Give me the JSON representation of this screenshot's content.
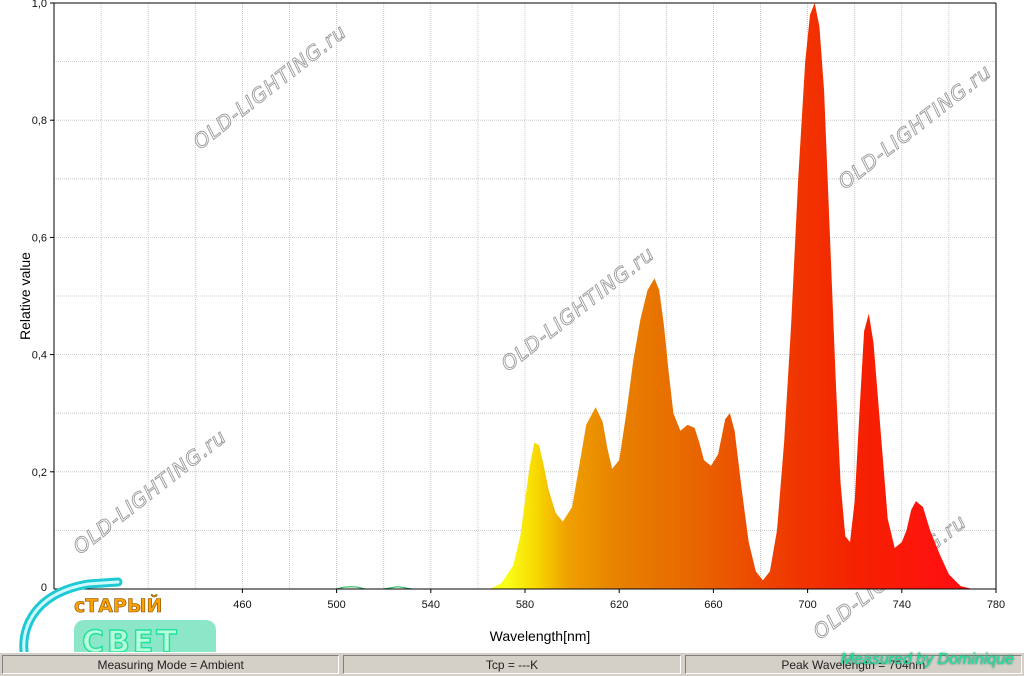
{
  "chart_data": {
    "type": "area",
    "xlabel": "Wavelength[nm]",
    "ylabel": "Relative value",
    "xlim": [
      380,
      780
    ],
    "ylim": [
      0,
      1
    ],
    "grid": true,
    "x_ticks": [
      "460",
      "500",
      "540",
      "580",
      "620",
      "660",
      "700",
      "740",
      "780"
    ],
    "y_ticks": [
      "0,2",
      "0,4",
      "0,6",
      "0,8",
      "1,0"
    ],
    "y_zero_label": "0",
    "x": [
      565,
      570,
      575,
      578,
      580,
      582,
      584,
      586,
      588,
      590,
      593,
      596,
      600,
      603,
      606,
      610,
      613,
      615,
      617,
      620,
      623,
      626,
      629,
      632,
      635,
      637,
      639,
      641,
      643,
      646,
      649,
      652,
      654,
      656,
      659,
      662,
      665,
      667,
      669,
      672,
      675,
      678,
      681,
      684,
      687,
      690,
      693,
      696,
      699,
      701,
      703,
      705,
      707,
      709,
      712,
      714,
      716,
      718,
      720,
      722,
      724,
      726,
      728,
      731,
      734,
      737,
      740,
      742,
      744,
      746,
      749,
      752,
      756,
      760,
      765,
      770
    ],
    "values": [
      0.0,
      0.01,
      0.04,
      0.09,
      0.15,
      0.21,
      0.25,
      0.245,
      0.21,
      0.17,
      0.13,
      0.115,
      0.14,
      0.21,
      0.28,
      0.31,
      0.285,
      0.24,
      0.205,
      0.22,
      0.3,
      0.39,
      0.46,
      0.51,
      0.53,
      0.51,
      0.45,
      0.37,
      0.3,
      0.27,
      0.28,
      0.275,
      0.25,
      0.22,
      0.21,
      0.23,
      0.29,
      0.3,
      0.27,
      0.17,
      0.08,
      0.03,
      0.015,
      0.03,
      0.1,
      0.25,
      0.45,
      0.7,
      0.9,
      0.98,
      1.0,
      0.96,
      0.85,
      0.65,
      0.35,
      0.18,
      0.09,
      0.08,
      0.15,
      0.3,
      0.44,
      0.47,
      0.42,
      0.27,
      0.12,
      0.07,
      0.08,
      0.1,
      0.135,
      0.15,
      0.14,
      0.1,
      0.06,
      0.025,
      0.005,
      0.0
    ],
    "minor_traces": [
      {
        "x": [
          500,
          503,
          506,
          509,
          512
        ],
        "values": [
          0.0,
          0.003,
          0.004,
          0.003,
          0.0
        ],
        "color": "#33bb66"
      },
      {
        "x": [
          520,
          523,
          526,
          529,
          532
        ],
        "values": [
          0.0,
          0.002,
          0.004,
          0.002,
          0.0
        ],
        "color": "#33bb66"
      }
    ],
    "gradient_stops": [
      {
        "nm": 572,
        "color": "#f8ff1a"
      },
      {
        "nm": 585,
        "color": "#f8d800"
      },
      {
        "nm": 598,
        "color": "#efa000"
      },
      {
        "nm": 620,
        "color": "#e88000"
      },
      {
        "nm": 650,
        "color": "#e86800"
      },
      {
        "nm": 690,
        "color": "#ef3b00"
      },
      {
        "nm": 720,
        "color": "#f52200"
      },
      {
        "nm": 760,
        "color": "#ff1010"
      }
    ]
  },
  "watermark_text": "OLD-LIGHTING.ru",
  "status_bar": {
    "measuring_mode": "Measuring Mode = Ambient",
    "tcp": "Tcp = ---K",
    "peak_wavelength": "Peak Wavelength = 704nm"
  },
  "credit": "Measured by Dominique",
  "logo": {
    "top": "сТАРЫЙ",
    "bottom": "СВЕТ"
  },
  "colors": {
    "grid": "#bdbdbd",
    "background": "#ffffff"
  }
}
